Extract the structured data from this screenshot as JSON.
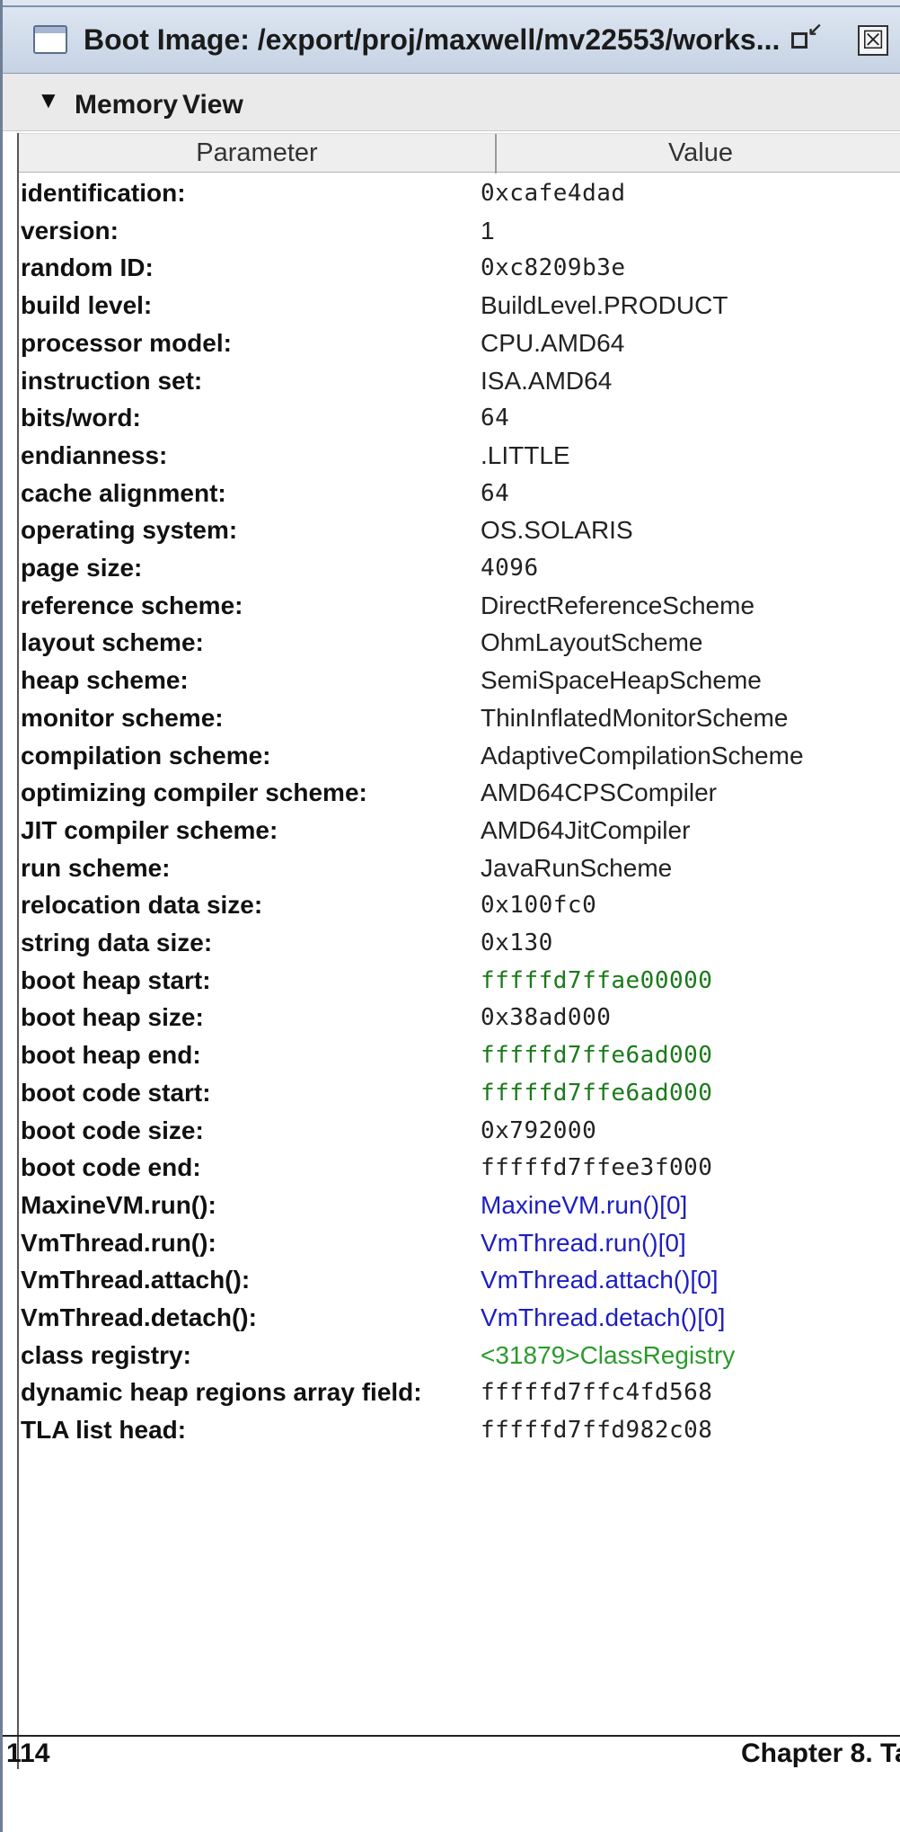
{
  "window": {
    "title": "Boot Image: /export/proj/maxwell/mv22553/works...",
    "close_glyph": "☒"
  },
  "menu": {
    "arrow_glyph": "▼",
    "items": [
      "Memory",
      "View"
    ]
  },
  "table": {
    "columns": [
      "Parameter",
      "Value"
    ],
    "rows": [
      {
        "parameter": "identification:",
        "value": "0xcafe4dad",
        "style": "mono"
      },
      {
        "parameter": "version:",
        "value": "1",
        "style": "sans"
      },
      {
        "parameter": "random ID:",
        "value": "0xc8209b3e",
        "style": "mono"
      },
      {
        "parameter": "build level:",
        "value": "BuildLevel.PRODUCT",
        "style": "sans"
      },
      {
        "parameter": "processor model:",
        "value": "CPU.AMD64",
        "style": "sans"
      },
      {
        "parameter": "instruction set:",
        "value": "ISA.AMD64",
        "style": "sans"
      },
      {
        "parameter": "bits/word:",
        "value": "64",
        "style": "mono"
      },
      {
        "parameter": "endianness:",
        "value": ".LITTLE",
        "style": "sans"
      },
      {
        "parameter": "cache alignment:",
        "value": "64",
        "style": "mono"
      },
      {
        "parameter": "operating system:",
        "value": "OS.SOLARIS",
        "style": "sans"
      },
      {
        "parameter": "page size:",
        "value": "4096",
        "style": "mono"
      },
      {
        "parameter": "reference scheme:",
        "value": "DirectReferenceScheme",
        "style": "sans"
      },
      {
        "parameter": "layout scheme:",
        "value": "OhmLayoutScheme",
        "style": "sans"
      },
      {
        "parameter": "heap scheme:",
        "value": "SemiSpaceHeapScheme",
        "style": "sans"
      },
      {
        "parameter": "monitor scheme:",
        "value": "ThinInflatedMonitorScheme",
        "style": "sans"
      },
      {
        "parameter": "compilation scheme:",
        "value": "AdaptiveCompilationScheme",
        "style": "sans"
      },
      {
        "parameter": "optimizing compiler scheme:",
        "value": "AMD64CPSCompiler",
        "style": "sans"
      },
      {
        "parameter": "JIT compiler scheme:",
        "value": "AMD64JitCompiler",
        "style": "sans"
      },
      {
        "parameter": "run scheme:",
        "value": "JavaRunScheme",
        "style": "sans"
      },
      {
        "parameter": "relocation data size:",
        "value": "0x100fc0",
        "style": "mono"
      },
      {
        "parameter": "string data size:",
        "value": "0x130",
        "style": "mono"
      },
      {
        "parameter": "boot heap start:",
        "value": "fffffd7ffae00000",
        "style": "mono green"
      },
      {
        "parameter": "boot heap size:",
        "value": "0x38ad000",
        "style": "mono"
      },
      {
        "parameter": "boot heap end:",
        "value": "fffffd7ffe6ad000",
        "style": "mono green"
      },
      {
        "parameter": "boot code start:",
        "value": "fffffd7ffe6ad000",
        "style": "mono green"
      },
      {
        "parameter": "boot code size:",
        "value": "0x792000",
        "style": "mono"
      },
      {
        "parameter": "boot code end:",
        "value": "fffffd7ffee3f000",
        "style": "mono"
      },
      {
        "parameter": "MaxineVM.run():",
        "value": "MaxineVM.run()[0]",
        "style": "sans blue"
      },
      {
        "parameter": "VmThread.run():",
        "value": "VmThread.run()[0]",
        "style": "sans blue"
      },
      {
        "parameter": "VmThread.attach():",
        "value": "VmThread.attach()[0]",
        "style": "sans blue"
      },
      {
        "parameter": "VmThread.detach():",
        "value": "VmThread.detach()[0]",
        "style": "sans blue"
      },
      {
        "parameter": "class registry:",
        "value": "<31879>ClassRegistry",
        "style": "sans lgreen"
      },
      {
        "parameter": "dynamic heap regions array field:",
        "value": "fffffd7ffc4fd568",
        "style": "mono"
      },
      {
        "parameter": "TLA list head:",
        "value": "fffffd7ffd982c08",
        "style": "mono"
      }
    ]
  },
  "footer": {
    "page_number": "114",
    "chapter": "Chapter 8. Ta"
  }
}
